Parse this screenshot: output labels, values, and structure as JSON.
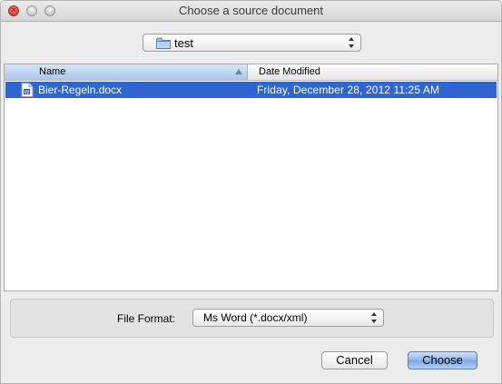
{
  "window": {
    "title": "Choose a source document"
  },
  "location": {
    "folder": "test"
  },
  "filelist": {
    "columns": {
      "name": "Name",
      "date": "Date Modified"
    },
    "rows": [
      {
        "name": "Bier-Regeln.docx",
        "date": "Friday, December 28, 2012 11:25 AM",
        "icon": "docx-file-icon"
      }
    ]
  },
  "format": {
    "label": "File Format:",
    "value": "Ms Word (*.docx/xml)"
  },
  "buttons": {
    "cancel": "Cancel",
    "choose": "Choose"
  },
  "colors": {
    "selection": "#2f65d0",
    "default_button": "#8db6ec"
  }
}
